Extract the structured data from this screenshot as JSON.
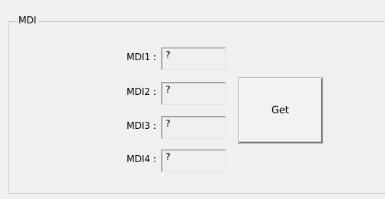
{
  "group": {
    "title": "MDI"
  },
  "fields": [
    {
      "label": "MDI1 :",
      "value": "?"
    },
    {
      "label": "MDI2 :",
      "value": "?"
    },
    {
      "label": "MDI3 :",
      "value": "?"
    },
    {
      "label": "MDI4 :",
      "value": "?"
    }
  ],
  "actions": {
    "get_label": "Get"
  }
}
